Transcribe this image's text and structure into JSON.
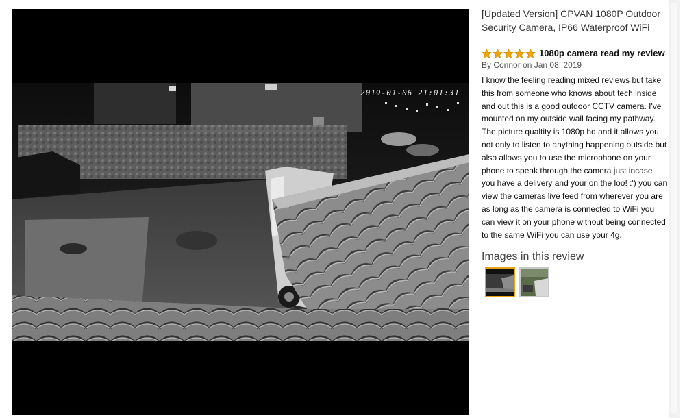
{
  "viewer": {
    "timestamp": "2019-01-06 21:01:31",
    "background": "#000000"
  },
  "product": {
    "title": "[Updated Version] CPVAN 1080P Outdoor Security Camera, IP66 Waterproof WiFi"
  },
  "review": {
    "rating": 5,
    "rating_max": 5,
    "star_color": "#f0a500",
    "title": "1080p camera read my review",
    "byline": "By Connor on Jan 08, 2019",
    "body": "I know the feeling reading mixed reviews but take this from someone who knows about tech inside and out this is a good outdoor CCTV camera. I've mounted on my outside wall facing my pathway. The picture qualtity is 1080p hd and it allows you not only to listen to anything happening outside but also allows you to use the microphone on your phone to speak through the camera just incase you have a delivery and your on the loo! :') you can view the cameras live feed from wherever you are as long as the camera is connected to WiFi you can view it on your phone without being connected to the same WiFi you can use your 4g."
  },
  "images": {
    "heading": "Images in this review",
    "selected_index": 0,
    "selected_border_color": "#e8a317"
  }
}
